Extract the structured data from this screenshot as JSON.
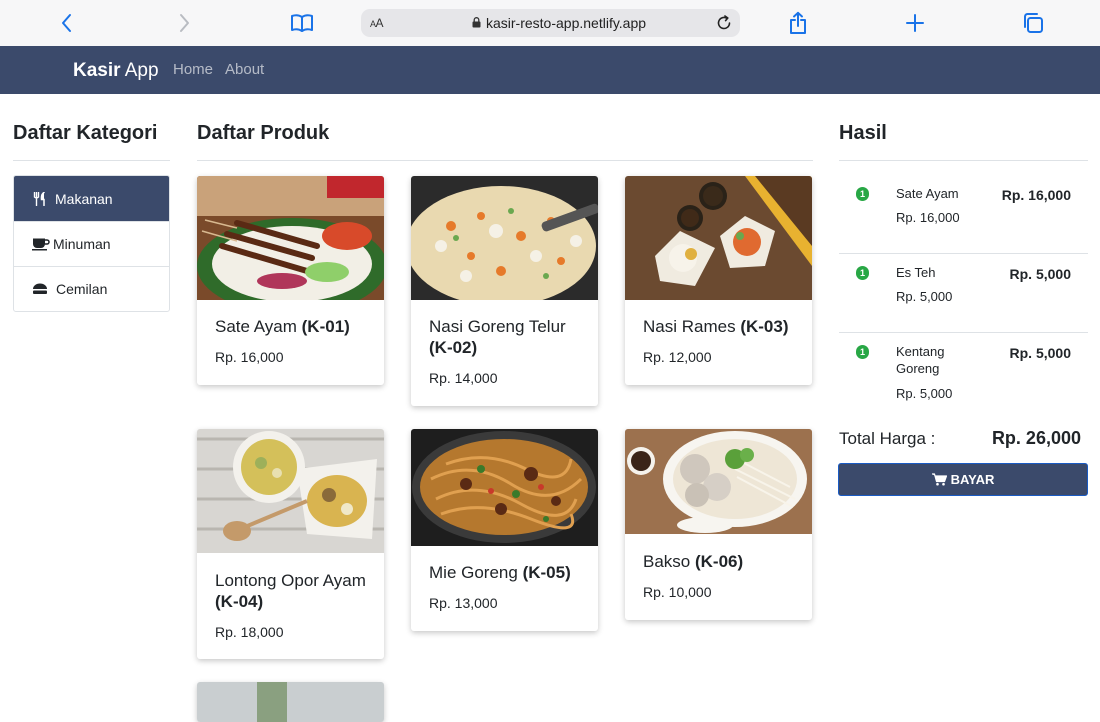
{
  "browser": {
    "url_prefix": "AA",
    "url": "kasir-resto-app.netlify.app"
  },
  "navbar": {
    "brand_bold": "Kasir",
    "brand_rest": " App",
    "links": [
      "Home",
      "About"
    ]
  },
  "categories": {
    "title": "Daftar Kategori",
    "items": [
      {
        "label": "Makanan",
        "icon": "utensils-icon",
        "active": true
      },
      {
        "label": "Minuman",
        "icon": "coffee-icon",
        "active": false
      },
      {
        "label": "Cemilan",
        "icon": "snack-icon",
        "active": false
      }
    ]
  },
  "products": {
    "title": "Daftar Produk",
    "items": [
      {
        "name": "Sate Ayam",
        "code": "(K-01)",
        "price": "Rp. 16,000"
      },
      {
        "name": "Nasi Goreng Telur",
        "code": "(K-02)",
        "price": "Rp. 14,000"
      },
      {
        "name": "Nasi Rames",
        "code": "(K-03)",
        "price": "Rp. 12,000"
      },
      {
        "name": "Lontong Opor Ayam",
        "code": "(K-04)",
        "price": "Rp. 18,000"
      },
      {
        "name": "Mie Goreng",
        "code": "(K-05)",
        "price": "Rp. 13,000"
      },
      {
        "name": "Bakso",
        "code": "(K-06)",
        "price": "Rp. 10,000"
      }
    ]
  },
  "hasil": {
    "title": "Hasil",
    "items": [
      {
        "qty": "1",
        "name": "Sate Ayam",
        "price": "Rp. 16,000",
        "total": "Rp. 16,000"
      },
      {
        "qty": "1",
        "name": "Es Teh",
        "price": "Rp. 5,000",
        "total": "Rp. 5,000"
      },
      {
        "qty": "1",
        "name": "Kentang Goreng",
        "price": "Rp. 5,000",
        "total": "Rp. 5,000"
      }
    ],
    "total_label": "Total Harga :",
    "total_value": "Rp. 26,000",
    "pay_label": "BAYAR"
  },
  "colors": {
    "navbar": "#3b4a6b",
    "badge": "#28a745",
    "safari_blue": "#1a73e8"
  }
}
